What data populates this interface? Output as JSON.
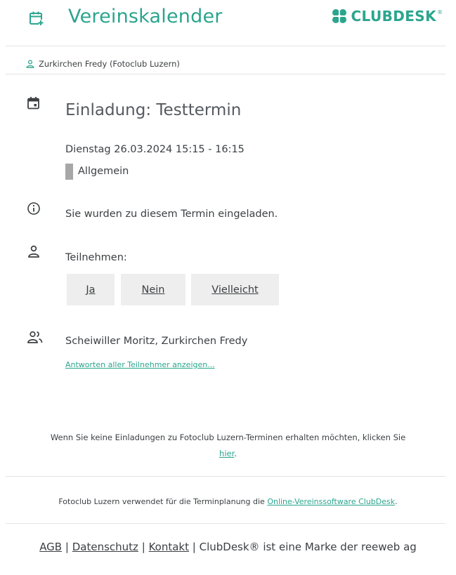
{
  "header": {
    "title": "Vereinskalender",
    "brand": "CLUBDESK",
    "brand_reg": "®",
    "icon": "calendar-add-icon"
  },
  "user": {
    "name": "Zurkirchen Fredy (Fotoclub Luzern)",
    "icon": "user-icon"
  },
  "event": {
    "title": "Einladung: Testtermin",
    "date": "Dienstag 26.03.2024 15:15 - 16:15",
    "category": "Allgemein",
    "category_color": "#a7a7a7",
    "info": "Sie wurden zu diesem Termin eingeladen.",
    "participate_label": "Teilnehmen:",
    "buttons": {
      "yes": "Ja",
      "no": "Nein",
      "maybe": "Vielleicht"
    },
    "participants": "Scheiwiller Moritz, Zurkirchen Fredy",
    "answers_link": "Antworten aller Teilnehmer anzeigen..."
  },
  "notice": {
    "text": "Wenn Sie keine Einladungen zu Fotoclub Luzern-Terminen erhalten möchten, klicken Sie",
    "link": "hier",
    "end": "."
  },
  "software": {
    "text": "Fotoclub Luzern verwendet für die Terminplanung die",
    "link": "Online-Vereinssoftware ClubDesk",
    "end": "."
  },
  "footer": {
    "agb": "AGB",
    "privacy": "Datenschutz",
    "contact": "Kontakt",
    "separator": "|",
    "trademark": "ClubDesk® ist eine Marke der reeweb ag"
  },
  "colors": {
    "accent": "#2ba58e",
    "text": "#3c4043",
    "button_bg": "#eeeeee"
  }
}
